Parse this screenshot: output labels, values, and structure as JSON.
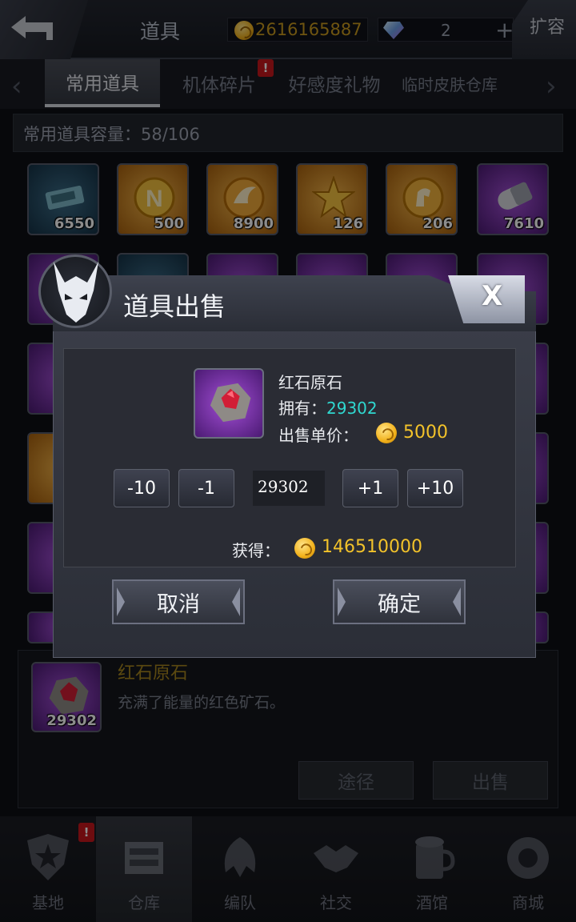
{
  "topbar": {
    "title": "道具",
    "gold": "2616165887",
    "gems": "2",
    "gem_plus": "+",
    "expand_label": "扩容"
  },
  "tabs": [
    {
      "label": "常用道具",
      "active": true
    },
    {
      "label": "机体碎片",
      "badge": "!"
    },
    {
      "label": "好感度礼物"
    },
    {
      "label": "临时皮肤仓库"
    }
  ],
  "capacity": "常用道具容量：58/106",
  "grid_row1": [
    {
      "count": "6550",
      "color": "blue",
      "icon": "data-chip-icon"
    },
    {
      "count": "500",
      "color": "gold",
      "icon": "n-coin-icon"
    },
    {
      "count": "8900",
      "color": "gold",
      "icon": "wing-coin-icon"
    },
    {
      "count": "126",
      "color": "gold",
      "icon": "star-emblem-icon"
    },
    {
      "count": "206",
      "color": "gold",
      "icon": "horse-coin-icon"
    },
    {
      "count": "7610",
      "color": "purple",
      "icon": "capsule-icon"
    }
  ],
  "dialog": {
    "title": "道具出售",
    "close": "X",
    "item_name": "红石原石",
    "own_label": "拥有：",
    "own_value": "29302",
    "price_label": "出售单价：",
    "price_value": "5000",
    "steps": [
      "-10",
      "-1",
      "+1",
      "+10"
    ],
    "quantity": "29302",
    "gain_label": "获得：",
    "gain_value": "146510000",
    "cancel": "取消",
    "confirm": "确定"
  },
  "detail": {
    "name": "红石原石",
    "description": "充满了能量的红色矿石。",
    "count": "29302",
    "source_button": "途径",
    "sell_button": "出售"
  },
  "bottom_nav": [
    {
      "label": "基地",
      "icon": "base-icon",
      "badge": "!"
    },
    {
      "label": "仓库",
      "icon": "warehouse-icon",
      "active": true
    },
    {
      "label": "编队",
      "icon": "formation-icon"
    },
    {
      "label": "社交",
      "icon": "handshake-icon"
    },
    {
      "label": "酒馆",
      "icon": "tavern-icon"
    },
    {
      "label": "商城",
      "icon": "shop-icon"
    }
  ]
}
